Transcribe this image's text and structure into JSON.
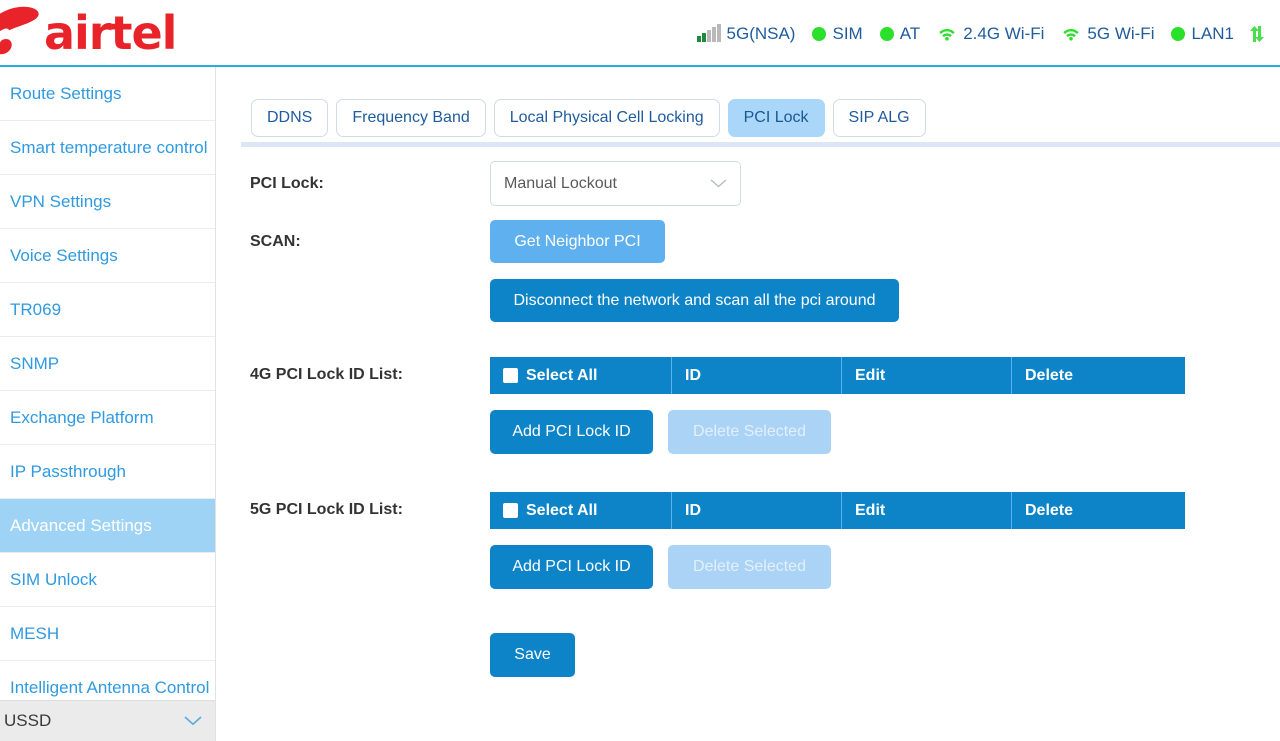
{
  "brand": {
    "name": "airtel",
    "color": "#e8232a"
  },
  "status": {
    "items": [
      {
        "icon": "signal-bars-icon",
        "label": "5G(NSA)"
      },
      {
        "icon": "status-dot-icon",
        "label": "SIM"
      },
      {
        "icon": "status-dot-icon",
        "label": "AT"
      },
      {
        "icon": "wifi-icon",
        "label": "2.4G Wi-Fi"
      },
      {
        "icon": "wifi-icon",
        "label": "5G Wi-Fi"
      },
      {
        "icon": "status-dot-icon",
        "label": "LAN1"
      }
    ],
    "transfer_icon": "data-transfer-icon",
    "dot_color": "#2ae02a",
    "text_color": "#1f5c9e"
  },
  "sidebar": {
    "items": [
      {
        "label": "Route Settings",
        "active": false
      },
      {
        "label": "Smart temperature control",
        "active": false
      },
      {
        "label": "VPN Settings",
        "active": false
      },
      {
        "label": "Voice Settings",
        "active": false
      },
      {
        "label": "TR069",
        "active": false
      },
      {
        "label": "SNMP",
        "active": false
      },
      {
        "label": "Exchange Platform",
        "active": false
      },
      {
        "label": "IP Passthrough",
        "active": false
      },
      {
        "label": "Advanced Settings",
        "active": true
      },
      {
        "label": "SIM Unlock",
        "active": false
      },
      {
        "label": "MESH",
        "active": false
      },
      {
        "label": "Intelligent Antenna Control",
        "active": false
      }
    ],
    "section": {
      "label": "USSD",
      "icon": "chevron-down-icon"
    },
    "active_bg": "#9fd3f5"
  },
  "tabs": [
    {
      "label": "DDNS",
      "active": false
    },
    {
      "label": "Frequency Band",
      "active": false
    },
    {
      "label": "Local Physical Cell Locking",
      "active": false
    },
    {
      "label": "PCI Lock",
      "active": true
    },
    {
      "label": "SIP ALG",
      "active": false
    }
  ],
  "form": {
    "pci_lock": {
      "label": "PCI Lock:",
      "value": "Manual Lockout",
      "options": [
        "Manual Lockout"
      ],
      "chevron": "chevron-down-icon"
    },
    "scan": {
      "label": "SCAN:",
      "get_neighbor_button": "Get Neighbor PCI",
      "disconnect_button": "Disconnect the network and scan all the pci around"
    },
    "list_4g": {
      "label": "4G PCI Lock ID List:",
      "columns": [
        "Select All",
        "ID",
        "Edit",
        "Delete"
      ],
      "rows": [],
      "add_button": "Add PCI Lock ID",
      "delete_button": "Delete Selected",
      "delete_disabled": true
    },
    "list_5g": {
      "label": "5G PCI Lock ID List:",
      "columns": [
        "Select All",
        "ID",
        "Edit",
        "Delete"
      ],
      "rows": [],
      "add_button": "Add PCI Lock ID",
      "delete_button": "Delete Selected",
      "delete_disabled": true
    },
    "save_button": "Save"
  },
  "colors": {
    "primary_blue": "#0d84c8",
    "light_blue": "#5fb0ee",
    "disabled_blue": "#aad3f5",
    "tab_active": "#aad6fa",
    "link": "#2f9ae0"
  }
}
